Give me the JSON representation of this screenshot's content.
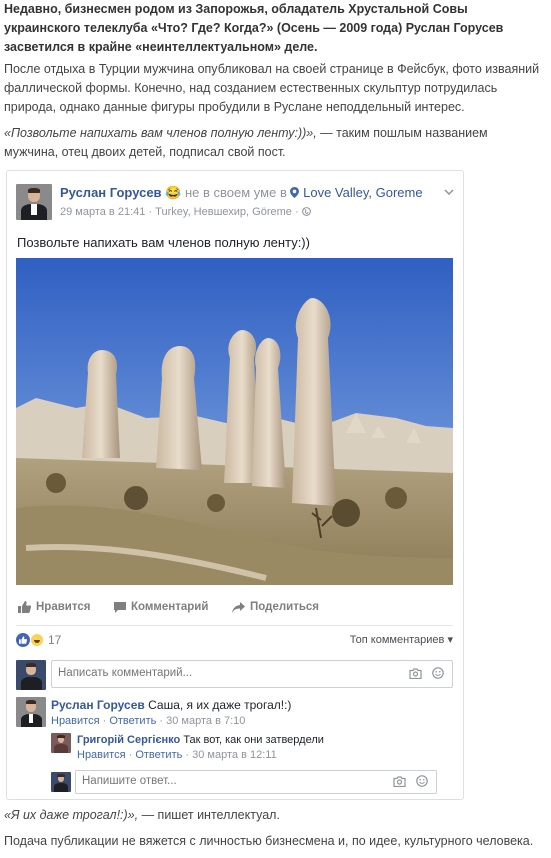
{
  "article": {
    "lead": "Недавно, бизнесмен родом из Запорожья, обладатель Хрустальной Совы украинского телеклуба «Что? Где? Когда?» (Осень — 2009 года) Руслан Горусев засветился в крайне «неинтеллектуальном» деле.",
    "p1": "После отдыха в Турции мужчина опубликовал на своей странице в Фейсбук, фото изваяний фаллической формы. Конечно, над созданием естественных скульптур потрудилась природа, однако данные фигуры пробудили в Руслане неподдельный интерес.",
    "p2_quote": "«Позвольте напихать вам членов полную ленту:))»,",
    "p2_rest": " — таким пошлым названием мужчина, отец двоих детей, подписал свой пост.",
    "p3_quote": "«Я их даже трогал!:)»,",
    "p3_rest": " — пишет интеллектуал.",
    "p4": "Подача публикации не вяжется с личностью бизнесмена и, по идее, культурного человека."
  },
  "post": {
    "author": "Руслан Горусев",
    "mood_emoji": "😂",
    "mood": "не в своем уме в",
    "location_icon": "pin-icon",
    "location": "Love Valley, Goreme",
    "date": "29 марта в 21:41",
    "place": "Turkey, Невшехир, Göreme",
    "privacy_icon": "globe-icon",
    "text": "Позвольте напихать вам членов полную ленту:))",
    "photo_alt": "Фото: скальные столбы в Долине любви, Гёреме"
  },
  "actions": {
    "like": "Нравится",
    "comment": "Комментарий",
    "share": "Поделиться"
  },
  "reactions": {
    "count": "17",
    "sort_label": "Топ комментариев"
  },
  "comment_box": {
    "placeholder": "Написать комментарий..."
  },
  "comments": [
    {
      "author": "Руслан Горусев",
      "text": "Саша, я их даже трогал!:)",
      "like": "Нравится",
      "reply": "Ответить",
      "time": "30 марта в 7:10"
    },
    {
      "author": "Григорій Сергієнко",
      "text": "Так вот, как они затвердели",
      "like": "Нравится",
      "reply": "Ответить",
      "time": "30 марта в 12:11"
    }
  ],
  "reply_box": {
    "placeholder": "Напишите ответ..."
  },
  "colors": {
    "fb_blue": "#365899",
    "link_blue": "#4267b2",
    "meta_gray": "#90949c",
    "sky": "#4a7bd0"
  }
}
